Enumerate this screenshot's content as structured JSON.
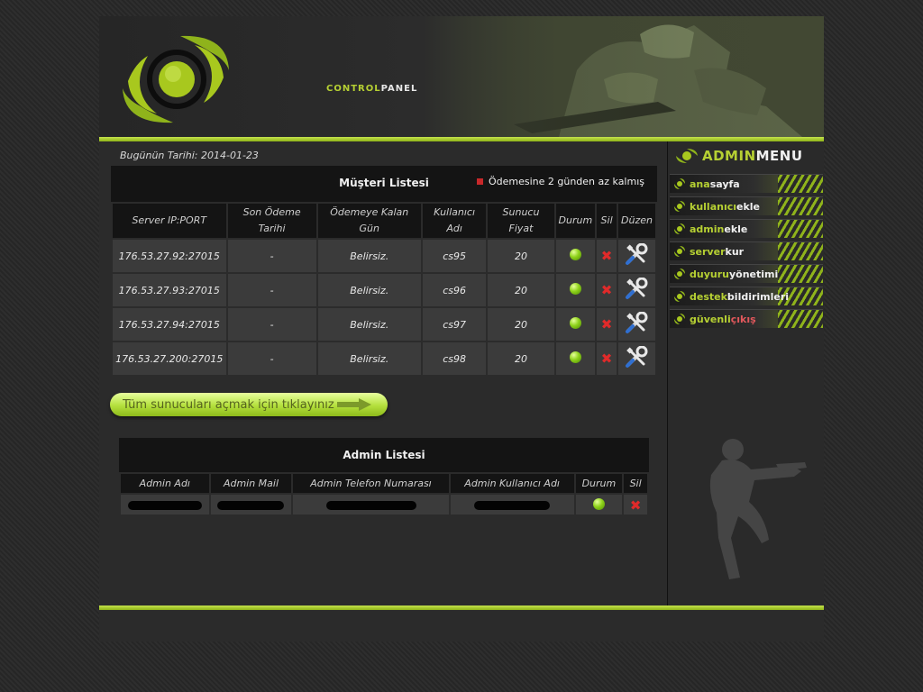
{
  "header": {
    "title_part1": "CONTROL",
    "title_part2": "PANEL"
  },
  "main": {
    "date_label": "Bugünün Tarihi: 2014-01-23",
    "customer_list": {
      "title": "Müşteri Listesi",
      "legend": "Ödemesine 2 günden az kalmış",
      "columns": [
        "Server IP:PORT",
        "Son Ödeme Tarihi",
        "Ödemeye Kalan Gün",
        "Kullanıcı Adı",
        "Sunucu Fiyat",
        "Durum",
        "Sil",
        "Düzen"
      ],
      "rows": [
        {
          "ip": "176.53.27.92:27015",
          "last_payment": "-",
          "days_left": "Belirsiz.",
          "username": "cs95",
          "price": "20"
        },
        {
          "ip": "176.53.27.93:27015",
          "last_payment": "-",
          "days_left": "Belirsiz.",
          "username": "cs96",
          "price": "20"
        },
        {
          "ip": "176.53.27.94:27015",
          "last_payment": "-",
          "days_left": "Belirsiz.",
          "username": "cs97",
          "price": "20"
        },
        {
          "ip": "176.53.27.200:27015",
          "last_payment": "-",
          "days_left": "Belirsiz.",
          "username": "cs98",
          "price": "20"
        }
      ]
    },
    "open_all_button": "Tüm sunucuları açmak için tıklayınız",
    "admin_list": {
      "title": "Admin Listesi",
      "columns": [
        "Admin Adı",
        "Admin Mail",
        "Admin Telefon Numarası",
        "Admin Kullanıcı Adı",
        "Durum",
        "Sil"
      ]
    }
  },
  "sidebar": {
    "menu_title_part1": "ADMIN",
    "menu_title_part2": "MENU",
    "items": [
      {
        "a": "ana",
        "b": "sayfa"
      },
      {
        "a": "kullanıcı",
        "b": "ekle"
      },
      {
        "a": "admin",
        "b": "ekle"
      },
      {
        "a": "server",
        "b": "kur"
      },
      {
        "a": "duyuru",
        "b": "yönetimi"
      },
      {
        "a": "destek",
        "b": "bildirimleri"
      },
      {
        "a": "güvenli",
        "r": "çıkış"
      }
    ]
  },
  "colors": {
    "accent": "#b6d033",
    "status_ok": "#8ed21a",
    "delete": "#e02a2a",
    "warning": "#c8282a"
  }
}
